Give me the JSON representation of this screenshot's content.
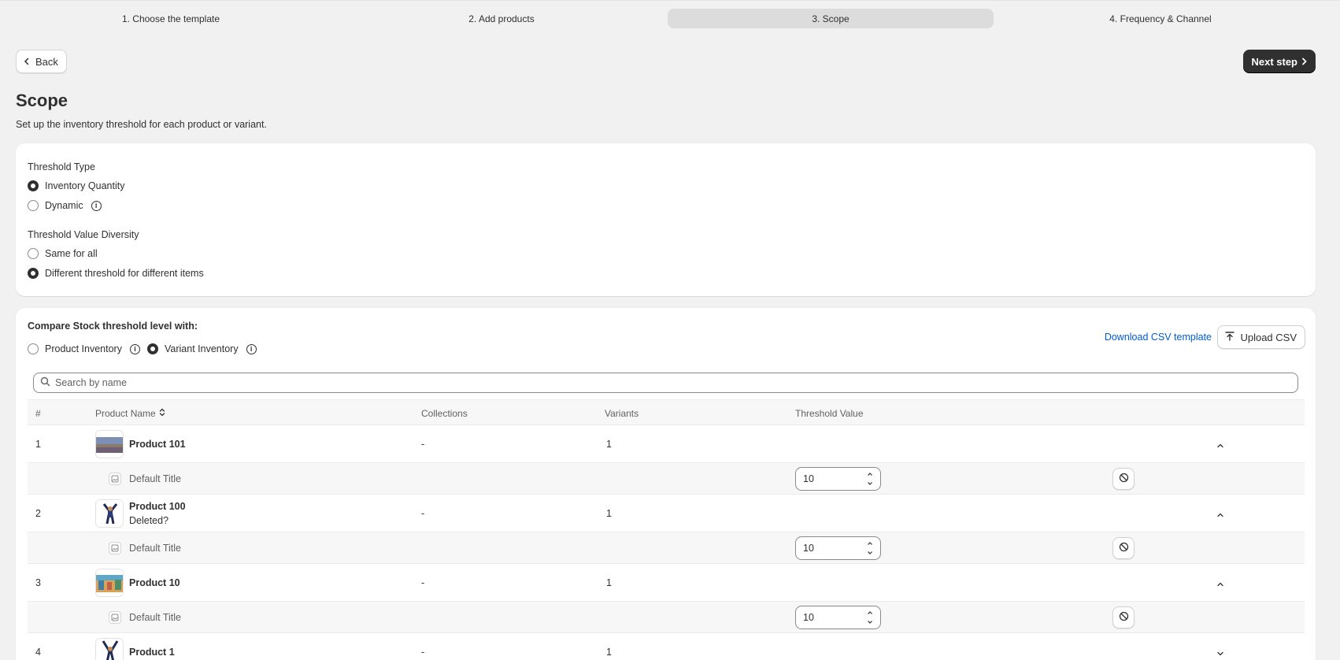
{
  "stepper": {
    "steps": [
      {
        "label": "1. Choose the template",
        "active": false
      },
      {
        "label": "2. Add products",
        "active": false
      },
      {
        "label": "3. Scope",
        "active": true
      },
      {
        "label": "4. Frequency & Channel",
        "active": false
      }
    ]
  },
  "nav": {
    "back_label": "Back",
    "next_label": "Next step"
  },
  "page": {
    "title": "Scope",
    "subtitle": "Set up the inventory threshold for each product or variant."
  },
  "threshold_type": {
    "label": "Threshold Type",
    "options": [
      {
        "label": "Inventory Quantity",
        "selected": true
      },
      {
        "label": "Dynamic",
        "selected": false
      }
    ]
  },
  "diversity": {
    "label": "Threshold Value Diversity",
    "options": [
      {
        "label": "Same for all",
        "selected": false
      },
      {
        "label": "Different threshold for different items",
        "selected": true
      }
    ]
  },
  "compare": {
    "label": "Compare Stock threshold level with:",
    "options": [
      {
        "label": "Product Inventory",
        "selected": false
      },
      {
        "label": "Variant Inventory",
        "selected": true
      }
    ],
    "download_csv": "Download CSV template",
    "upload_csv": "Upload CSV"
  },
  "search": {
    "placeholder": "Search by name"
  },
  "table": {
    "headers": {
      "num": "#",
      "name": "Product Name",
      "collections": "Collections",
      "variants": "Variants",
      "threshold": "Threshold Value"
    },
    "rows": [
      {
        "num": "1",
        "name": "Product 101",
        "note": "",
        "collections": "-",
        "variants": "1",
        "expanded": true,
        "variant": {
          "title": "Default Title",
          "threshold": "10"
        }
      },
      {
        "num": "2",
        "name": "Product 100",
        "note": "Deleted?",
        "collections": "-",
        "variants": "1",
        "expanded": true,
        "variant": {
          "title": "Default Title",
          "threshold": "10"
        }
      },
      {
        "num": "3",
        "name": "Product 10",
        "note": "",
        "collections": "-",
        "variants": "1",
        "expanded": true,
        "variant": {
          "title": "Default Title",
          "threshold": "10"
        }
      },
      {
        "num": "4",
        "name": "Product 1",
        "note": "",
        "collections": "-",
        "variants": "1",
        "expanded": false
      }
    ]
  },
  "colors": {
    "primary_button": "#303030",
    "link": "#005bd3",
    "page_bg": "#f1f1f1"
  }
}
